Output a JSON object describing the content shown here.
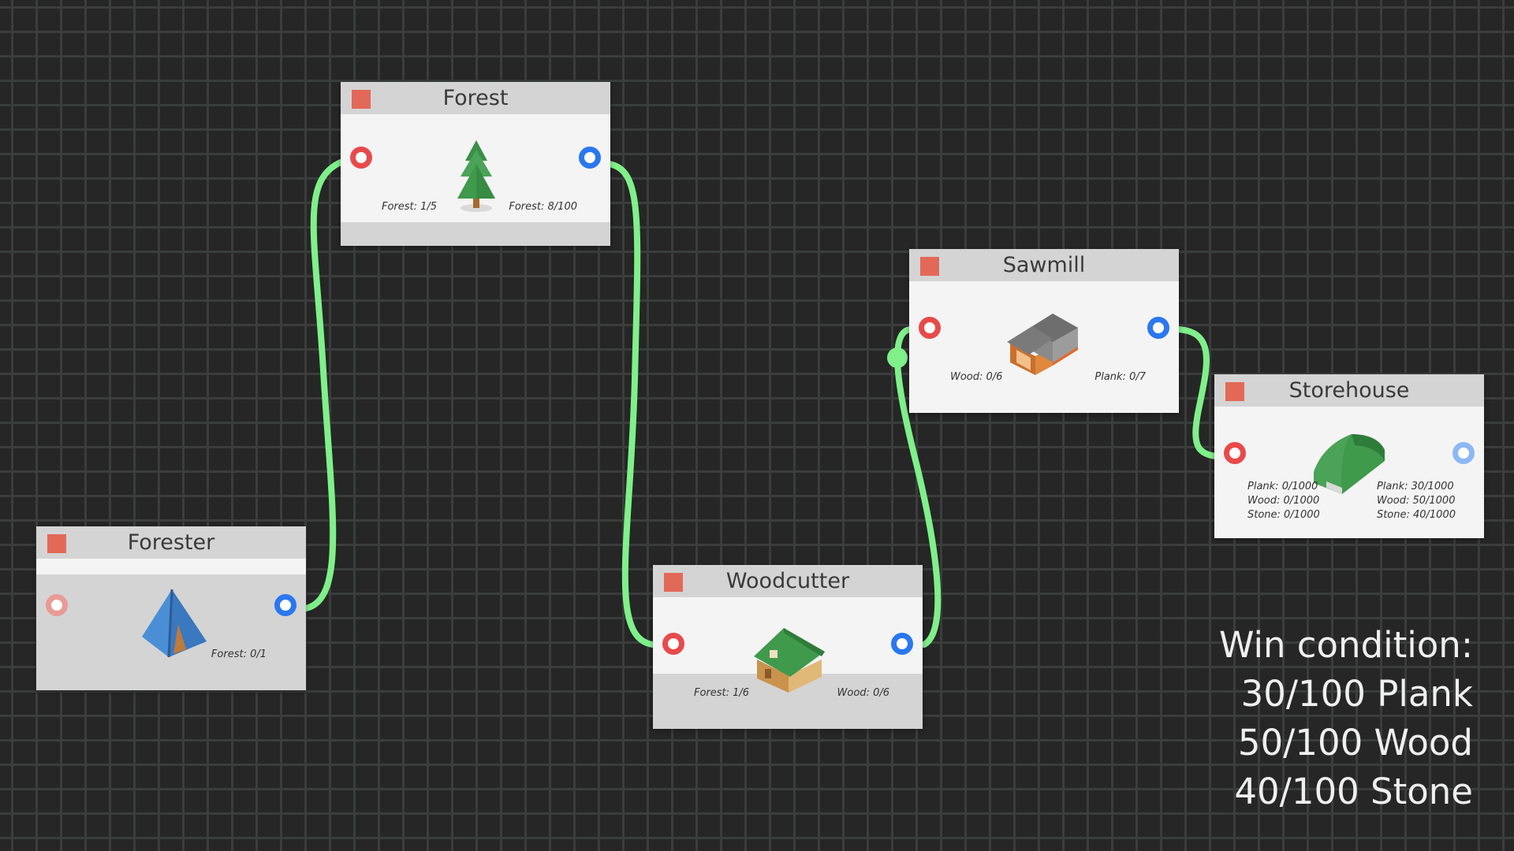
{
  "nodes": {
    "forest": {
      "title": "Forest",
      "input_stat": "Forest: 1/5",
      "output_stat": "Forest: 8/100",
      "icon": "pine-tree-icon"
    },
    "forester": {
      "title": "Forester",
      "output_stat": "Forest: 0/1",
      "icon": "tent-icon"
    },
    "woodcutter": {
      "title": "Woodcutter",
      "input_stat": "Forest: 1/6",
      "output_stat": "Wood: 0/6",
      "icon": "woodcutter-hut-icon"
    },
    "sawmill": {
      "title": "Sawmill",
      "input_stat": "Wood: 0/6",
      "output_stat": "Plank: 0/7",
      "icon": "sawmill-building-icon"
    },
    "storehouse": {
      "title": "Storehouse",
      "input_stats": [
        "Plank: 0/1000",
        "Wood: 0/1000",
        "Stone: 0/1000"
      ],
      "output_stats": [
        "Plank: 30/1000",
        "Wood: 50/1000",
        "Stone: 40/1000"
      ],
      "icon": "storehouse-barn-icon"
    }
  },
  "win_condition": {
    "title": "Win condition:",
    "lines": [
      "30/100 Plank",
      "50/100 Wood",
      "40/100 Stone"
    ]
  },
  "colors": {
    "background": "#262626",
    "grid": "#3a3d3b",
    "wire": "#7ff08a",
    "input_port": "#e84a4a",
    "output_port": "#2a77f0",
    "close_button": "#e26958",
    "node_header": "#d4d4d4"
  }
}
